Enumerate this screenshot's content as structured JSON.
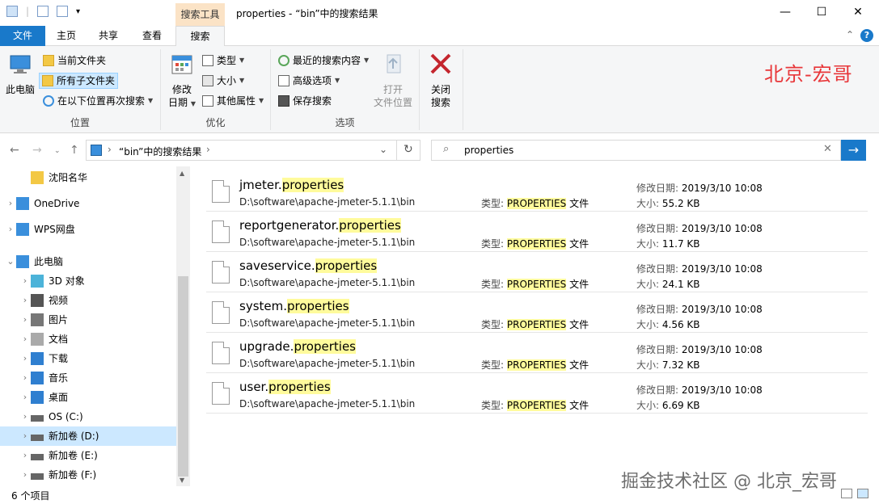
{
  "window": {
    "context_tab": "搜索工具",
    "title": "properties - “bin”中的搜索结果"
  },
  "tabs": {
    "file": "文件",
    "home": "主页",
    "share": "共享",
    "view": "查看",
    "search": "搜索"
  },
  "ribbon": {
    "location": {
      "label": "位置",
      "this_pc": "此电脑",
      "this_pc_line2": "脑",
      "current_folder": "当前文件夹",
      "all_subfolders": "所有子文件夹",
      "search_again": "在以下位置再次搜索"
    },
    "refine": {
      "label": "优化",
      "date_modified_1": "修改",
      "date_modified_2": "日期",
      "type": "类型",
      "size": "大小",
      "other_props": "其他属性"
    },
    "options": {
      "label": "选项",
      "recent_searches": "最近的搜索内容",
      "advanced": "高级选项",
      "save_search": "保存搜索",
      "open_location_1": "打开",
      "open_location_2": "文件位置"
    },
    "close": {
      "line1": "关闭",
      "line2": "搜索"
    },
    "brand": "北京-宏哥"
  },
  "address": {
    "path": "“bin”中的搜索结果",
    "search_value": "properties"
  },
  "nav": {
    "items": [
      {
        "label": "沈阳名华",
        "icon": "folder-icon",
        "chev": ""
      },
      {
        "label": "OneDrive",
        "icon": "cloud-icon",
        "chev": "›"
      },
      {
        "label": "WPS网盘",
        "icon": "cloud-icon",
        "chev": "›"
      },
      {
        "label": "此电脑",
        "icon": "computer-icon",
        "chev": "⌄"
      },
      {
        "label": "3D 对象",
        "icon": "cube-icon",
        "chev": "›"
      },
      {
        "label": "视频",
        "icon": "video-icon",
        "chev": "›"
      },
      {
        "label": "图片",
        "icon": "picture-icon",
        "chev": "›"
      },
      {
        "label": "文档",
        "icon": "document-icon",
        "chev": "›"
      },
      {
        "label": "下载",
        "icon": "download-icon",
        "chev": "›"
      },
      {
        "label": "音乐",
        "icon": "music-icon",
        "chev": "›"
      },
      {
        "label": "桌面",
        "icon": "desktop-icon",
        "chev": "›"
      },
      {
        "label": "OS (C:)",
        "icon": "drive-icon",
        "chev": "›"
      },
      {
        "label": "新加卷 (D:)",
        "icon": "drive-icon",
        "chev": "›"
      },
      {
        "label": "新加卷 (E:)",
        "icon": "drive-icon",
        "chev": "›"
      },
      {
        "label": "新加卷 (F:)",
        "icon": "drive-icon",
        "chev": "›"
      }
    ]
  },
  "results": {
    "type_label": "类型:",
    "type_value": "PROPERTIES",
    "type_suffix": "文件",
    "date_label": "修改日期:",
    "size_label": "大小:",
    "highlight": "properties",
    "files": [
      {
        "base": "jmeter.",
        "path": "D:\\software\\apache-jmeter-5.1.1\\bin",
        "date": "2019/3/10 10:08",
        "size": "55.2 KB"
      },
      {
        "base": "reportgenerator.",
        "path": "D:\\software\\apache-jmeter-5.1.1\\bin",
        "date": "2019/3/10 10:08",
        "size": "11.7 KB"
      },
      {
        "base": "saveservice.",
        "path": "D:\\software\\apache-jmeter-5.1.1\\bin",
        "date": "2019/3/10 10:08",
        "size": "24.1 KB"
      },
      {
        "base": "system.",
        "path": "D:\\software\\apache-jmeter-5.1.1\\bin",
        "date": "2019/3/10 10:08",
        "size": "4.56 KB"
      },
      {
        "base": "upgrade.",
        "path": "D:\\software\\apache-jmeter-5.1.1\\bin",
        "date": "2019/3/10 10:08",
        "size": "7.32 KB"
      },
      {
        "base": "user.",
        "path": "D:\\software\\apache-jmeter-5.1.1\\bin",
        "date": "2019/3/10 10:08",
        "size": "6.69 KB"
      }
    ]
  },
  "status": {
    "count": "6 个项目",
    "watermark": "掘金技术社区 @ 北京_宏哥"
  },
  "colors": {
    "accent": "#1979ca",
    "highlight": "#fffb9c",
    "context_tab": "#fbe3c6",
    "brand_red": "#e8373a"
  }
}
